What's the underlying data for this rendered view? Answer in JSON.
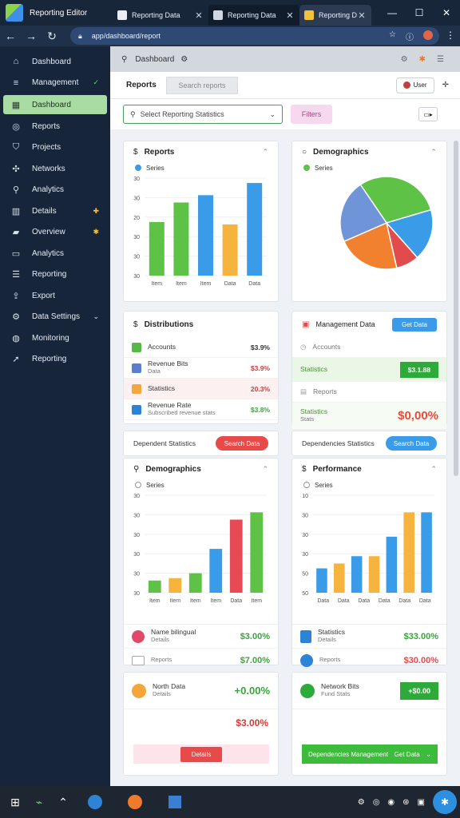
{
  "window": {
    "app_name": "Reporting Editor",
    "tabs": [
      {
        "label": "Reporting Data",
        "icon": "page-icon",
        "color": "#e9eef5"
      },
      {
        "label": "Reporting Data",
        "icon": "page-icon",
        "color": "#cfd7e2"
      },
      {
        "label": "Reporting Data",
        "icon": "app-icon",
        "color": "#f2c23a"
      }
    ],
    "url": "app/dashboard/report"
  },
  "sidebar": {
    "items": [
      {
        "icon": "home-icon",
        "glyph": "⌂",
        "label": "Dashboard",
        "badge": ""
      },
      {
        "icon": "list-icon",
        "glyph": "≡",
        "label": "Management",
        "badge": "✓"
      },
      {
        "icon": "chart-icon",
        "glyph": "▦",
        "label": "Dashboard",
        "badge": "",
        "active": true
      },
      {
        "icon": "report-icon",
        "glyph": "◎",
        "label": "Reports",
        "badge": ""
      },
      {
        "icon": "tag-icon",
        "glyph": "⛉",
        "label": "Projects",
        "badge": ""
      },
      {
        "icon": "network-icon",
        "glyph": "✣",
        "label": "Networks",
        "badge": ""
      },
      {
        "icon": "search-icon",
        "glyph": "⚲",
        "label": "Analytics",
        "badge": ""
      },
      {
        "icon": "table-icon",
        "glyph": "▥",
        "label": "Details",
        "badge": "✚"
      },
      {
        "icon": "folder-icon",
        "glyph": "▰",
        "label": "Overview",
        "badge": "✱"
      },
      {
        "icon": "terminal-icon",
        "glyph": "▭",
        "label": "Analytics",
        "badge": ""
      },
      {
        "icon": "layers-icon",
        "glyph": "☰",
        "label": "Reporting",
        "badge": ""
      },
      {
        "icon": "export-icon",
        "glyph": "⇪",
        "label": "Export",
        "badge": ""
      },
      {
        "icon": "settings-icon",
        "glyph": "⚙",
        "label": "Data Settings",
        "badge": "⌄"
      },
      {
        "icon": "globe-icon",
        "glyph": "◍",
        "label": "Monitoring",
        "badge": ""
      },
      {
        "icon": "run-icon",
        "glyph": "➚",
        "label": "Reporting",
        "badge": ""
      }
    ]
  },
  "page": {
    "top_label": "Dashboard",
    "title": "Reports",
    "subtitle": "Search reports",
    "user": "User",
    "filter_placeholder": "Select Reporting Statistics",
    "filter_pill": "Filters"
  },
  "cards": {
    "bar1": {
      "title": "Reports",
      "legend": "Series"
    },
    "pie": {
      "title": "Demographics",
      "legend": "Series"
    },
    "list1": {
      "title": "Distributions",
      "rows": [
        {
          "l1": "Accounts",
          "l2": "",
          "value": "$3.9%",
          "color": "#333333",
          "icon_color": "#56b847"
        },
        {
          "l1": "Revenue Bits",
          "l2": "Data",
          "value": "$3.9%",
          "color": "#d13a3a",
          "icon_color": "#5a7fd1"
        },
        {
          "l1": "Statistics",
          "l2": "",
          "value": "20.3%",
          "color": "#d13a3a",
          "icon_color": "#f4a640"
        },
        {
          "l1": "Revenue Rate",
          "l2": "Subscribed revenue stats",
          "value": "$3.8%",
          "color": "#3aa53a",
          "icon_color": "#2d83d6"
        }
      ]
    },
    "list2": {
      "title": "Management Data",
      "button": "Get Data",
      "rows": [
        {
          "l1": "Accounts",
          "value": ""
        },
        {
          "l1": "Statistics",
          "value": "$3.1.88",
          "highlight": true
        },
        {
          "l1": "Reports",
          "value": ""
        },
        {
          "l1": "Statistics",
          "l2": "Stats",
          "value": "$0,00%"
        }
      ]
    },
    "pillbar1": {
      "label": "Dependent Statistics",
      "button": "Search Data"
    },
    "pillbar2": {
      "label": "Dependencies Statistics",
      "button": "Search Data"
    },
    "bar2": {
      "title": "Demographics",
      "legend": "Series"
    },
    "bar3": {
      "title": "Performance",
      "legend": "Series"
    },
    "stat1": {
      "rows": [
        {
          "l1": "Name bilingual",
          "l2": "Details",
          "value": "$3.00%",
          "icon_color": "#e04a6a"
        },
        {
          "l1": "",
          "l2": "Reports",
          "value": "$7.00%",
          "icon_color": "#cccccc"
        }
      ]
    },
    "stat2": {
      "rows": [
        {
          "l1": "Statistics",
          "l2": "Details",
          "value": "$33.00%",
          "icon_color": "#2d83d6"
        },
        {
          "l1": "",
          "l2": "Reports",
          "value": "$30.00%",
          "icon_color": "#2d83d6"
        }
      ]
    },
    "kpi1": {
      "title": "North Data",
      "sub": "Details",
      "value": "+0.00%",
      "value2": "$3.00%"
    },
    "kpi2": {
      "title": "Network Bits",
      "sub": "Fund Stats",
      "button": "+$0.00"
    },
    "footer1": {
      "button": "Details"
    },
    "footer2": {
      "label": "Dependencies Management",
      "button": "Get Data"
    }
  },
  "chart_data": [
    {
      "type": "bar",
      "categories": [
        "Item",
        "Item",
        "Item",
        "Data",
        "Data"
      ],
      "values": [
        22,
        30,
        33,
        21,
        38
      ],
      "colors": [
        "#5ec247",
        "#5ec247",
        "#3a9be8",
        "#f6b43e",
        "#3a9be8"
      ],
      "ylim": [
        0,
        40
      ],
      "yticks": [
        "30",
        "30",
        "30",
        "20",
        "30",
        "30"
      ]
    },
    {
      "type": "pie",
      "values": [
        30,
        18,
        8,
        22,
        22
      ],
      "colors": [
        "#5ec247",
        "#3a9be8",
        "#e24b4b",
        "#f2812f",
        "#6f95d8"
      ]
    },
    {
      "type": "bar",
      "categories": [
        "Item",
        "Item",
        "Item",
        "Item",
        "Data",
        "Item"
      ],
      "values": [
        5,
        6,
        8,
        18,
        30,
        33
      ],
      "colors": [
        "#5ec247",
        "#f6b43e",
        "#5ec247",
        "#3a9be8",
        "#e84a55",
        "#5ec247"
      ],
      "ylim": [
        0,
        40
      ],
      "yticks": [
        "30",
        "30",
        "30",
        "30",
        "30",
        "30"
      ]
    },
    {
      "type": "bar",
      "categories": [
        "Data",
        "Data",
        "Data",
        "Data",
        "Data",
        "Data"
      ],
      "values": [
        10,
        12,
        15,
        15,
        23,
        33,
        33
      ],
      "colors": [
        "#3a9be8",
        "#f6b43e",
        "#3a9be8",
        "#f6b43e",
        "#3a9be8",
        "#f6b43e",
        "#3a9be8"
      ],
      "ylim": [
        0,
        40
      ],
      "yticks": [
        "50",
        "50",
        "30",
        "30",
        "30",
        "10"
      ]
    }
  ]
}
